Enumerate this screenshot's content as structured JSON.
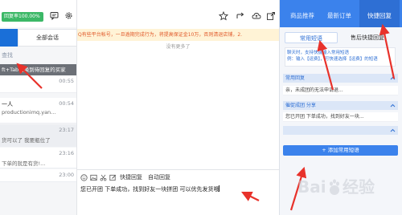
{
  "left": {
    "rate_badge": "回复率100.00%",
    "tabs": {
      "all": "全部会话"
    },
    "search_placeholder": "查找",
    "tooltip": "ft+Tab切换到待回复的买家",
    "conversations": [
      {
        "name": "",
        "sub": "",
        "time": "00:55"
      },
      {
        "name": "一人",
        "sub": "productionimq.yan...",
        "time": "00:54"
      },
      {
        "name": "",
        "sub": "货可以了 我要瓶位了",
        "time": "23:17"
      },
      {
        "name": "",
        "sub": "下单的就是有货!...",
        "time": "23:16"
      },
      {
        "name": "",
        "sub": "",
        "time": "23:00"
      }
    ]
  },
  "mid": {
    "notice": "Q有些平台帐号，一旦逾期完成行为，将提高保证金10万，否则清退店铺，2.",
    "no_more": "没有更多了",
    "toolbar": {
      "quick_reply": "快捷回复",
      "auto_reply": "自动回复"
    },
    "input_value": "您已开团 下单成功，找到好友一块拼团 可以优先发货哦"
  },
  "right": {
    "tabs": {
      "recommend": "商品推荐",
      "orders": "最新订单",
      "quick": "快捷回复"
    },
    "sub_tabs": {
      "common": "常用短语",
      "shop": "售后快捷回复"
    },
    "help_line1": "聊天时，支持快捷输入常用短语",
    "help_line2": "例：输入【运费】，可快速选择【运费】的短语",
    "groups": [
      {
        "title": "常用回复",
        "items": [
          "亲，未成团的无法申请退..."
        ]
      },
      {
        "title": "催促成团 分享",
        "items": [
          "您已开团 下单成功，找到好友一块..."
        ]
      }
    ],
    "add_button": "+ 添加常用短语"
  },
  "colors": {
    "brand_blue": "#3b82ec",
    "arrow_red": "#e8322b",
    "badge_green": "#3cb867"
  },
  "watermark": "Baidu经验"
}
